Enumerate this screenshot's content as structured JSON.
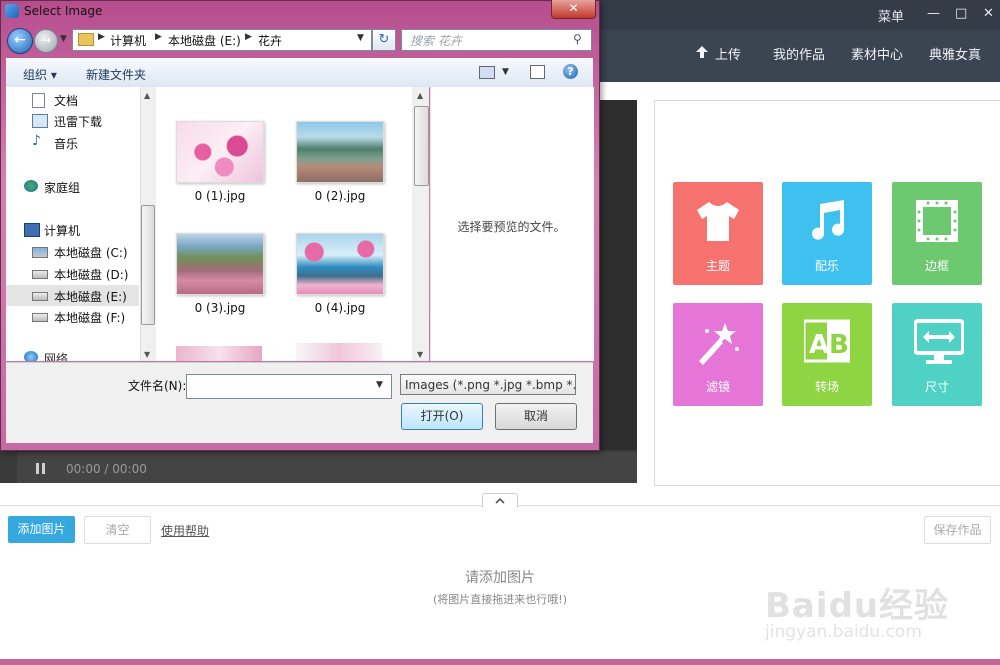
{
  "app": {
    "menu_label": "菜单",
    "minimize_glyph": "—",
    "restore_glyph": "□",
    "close_glyph": "✕",
    "nav": [
      {
        "label": "上传",
        "icon": "upload-icon"
      },
      {
        "label": "我的作品"
      },
      {
        "label": "素材中心"
      },
      {
        "label": "典雅女真"
      }
    ],
    "player_time": "00:00 / 00:00",
    "tools": [
      {
        "label": "主题",
        "icon": "tshirt-icon",
        "color": "#f5726f"
      },
      {
        "label": "配乐",
        "icon": "music-note-icon",
        "color": "#3fc1f0"
      },
      {
        "label": "边框",
        "icon": "frame-icon",
        "color": "#6dc970"
      },
      {
        "label": "滤镜",
        "icon": "magic-wand-icon",
        "color": "#e575d6"
      },
      {
        "label": "转场",
        "icon": "ab-transition-icon",
        "color": "#8fd443"
      },
      {
        "label": "尺寸",
        "icon": "screen-size-icon",
        "color": "#4fd1c5"
      }
    ],
    "buttons": {
      "add": "添加图片",
      "clear": "清空",
      "help": "使用帮助",
      "save": "保存作品"
    },
    "empty": {
      "title": "请添加图片",
      "subtitle": "(将图片直接拖进来也行哦!)"
    },
    "watermark": {
      "logo": "Baidu经验",
      "url": "jingyan.baidu.com"
    }
  },
  "dialog": {
    "title": "Select Image",
    "close_glyph": "✕",
    "breadcrumbs": [
      "计算机",
      "本地磁盘 (E:)",
      "花卉"
    ],
    "search_placeholder": "搜索 花卉",
    "toolbar": {
      "organize": "组织 ▾",
      "new_folder": "新建文件夹",
      "help_glyph": "?"
    },
    "nav_items": [
      {
        "label": "文档",
        "icon": "documents-icon"
      },
      {
        "label": "迅雷下载",
        "icon": "download-folder-icon"
      },
      {
        "label": "音乐",
        "icon": "music-icon"
      },
      {
        "label": "家庭组",
        "icon": "homegroup-icon"
      },
      {
        "label": "计算机",
        "icon": "computer-icon"
      },
      {
        "label": "本地磁盘 (C:)",
        "icon": "system-drive-icon"
      },
      {
        "label": "本地磁盘 (D:)",
        "icon": "drive-icon"
      },
      {
        "label": "本地磁盘 (E:)",
        "icon": "drive-icon",
        "selected": true
      },
      {
        "label": "本地磁盘 (F:)",
        "icon": "drive-icon"
      },
      {
        "label": "网络",
        "icon": "network-icon"
      }
    ],
    "files": [
      {
        "name": "0 (1).jpg"
      },
      {
        "name": "0 (2).jpg"
      },
      {
        "name": "0 (3).jpg"
      },
      {
        "name": "0 (4).jpg"
      }
    ],
    "preview_text": "选择要预览的文件。",
    "filename_label": "文件名(N):",
    "filename_value": "",
    "filter_value": "Images (*.png *.jpg *.bmp *.",
    "open_label": "打开(O)",
    "cancel_label": "取消"
  }
}
